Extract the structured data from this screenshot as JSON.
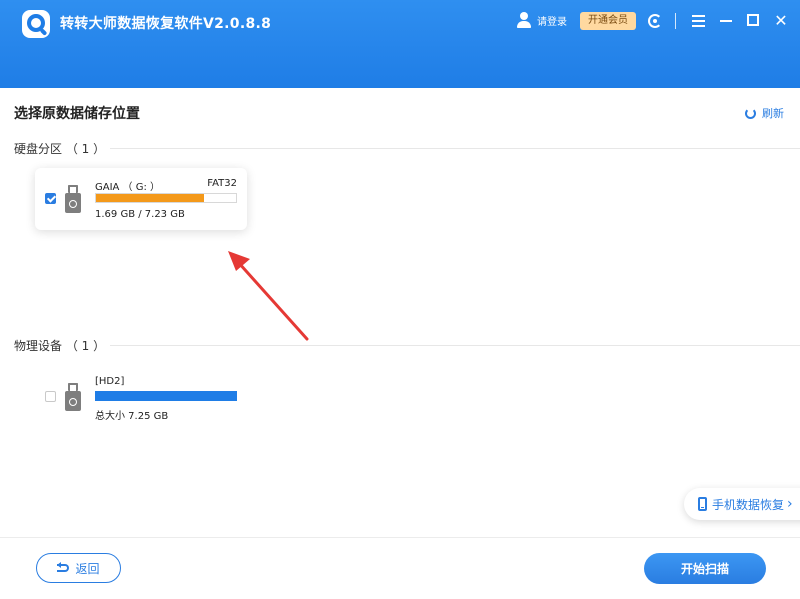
{
  "app": {
    "title": "转转大师数据恢复软件V2.0.8.8"
  },
  "header": {
    "login_label": "请登录",
    "vip_label": "开通会员",
    "close_glyph": "✕"
  },
  "page": {
    "title": "选择原数据储存位置",
    "refresh_label": "刷新"
  },
  "partitions": {
    "title": "硬盘分区 （ 1 ）",
    "items": [
      {
        "name": "GAIA （ G: ）",
        "filesystem": "FAT32",
        "size_text": "1.69 GB / 7.23 GB",
        "used_fraction": 0.77,
        "bar_color": "#f4991a",
        "checked": true
      }
    ]
  },
  "devices": {
    "title": "物理设备 （ 1 ）",
    "items": [
      {
        "name": "[HD2]",
        "size_text": "总大小 7.25 GB",
        "used_fraction": 1.0,
        "bar_color": "#1f7de6",
        "checked": false
      }
    ]
  },
  "colors": {
    "accent": "#2a7de1",
    "header": "#1f7de6",
    "arrow": "#e53935"
  },
  "phone_recovery": {
    "label": "手机数据恢复",
    "chevron": "›"
  },
  "footer": {
    "back_label": "返回",
    "scan_label": "开始扫描"
  }
}
